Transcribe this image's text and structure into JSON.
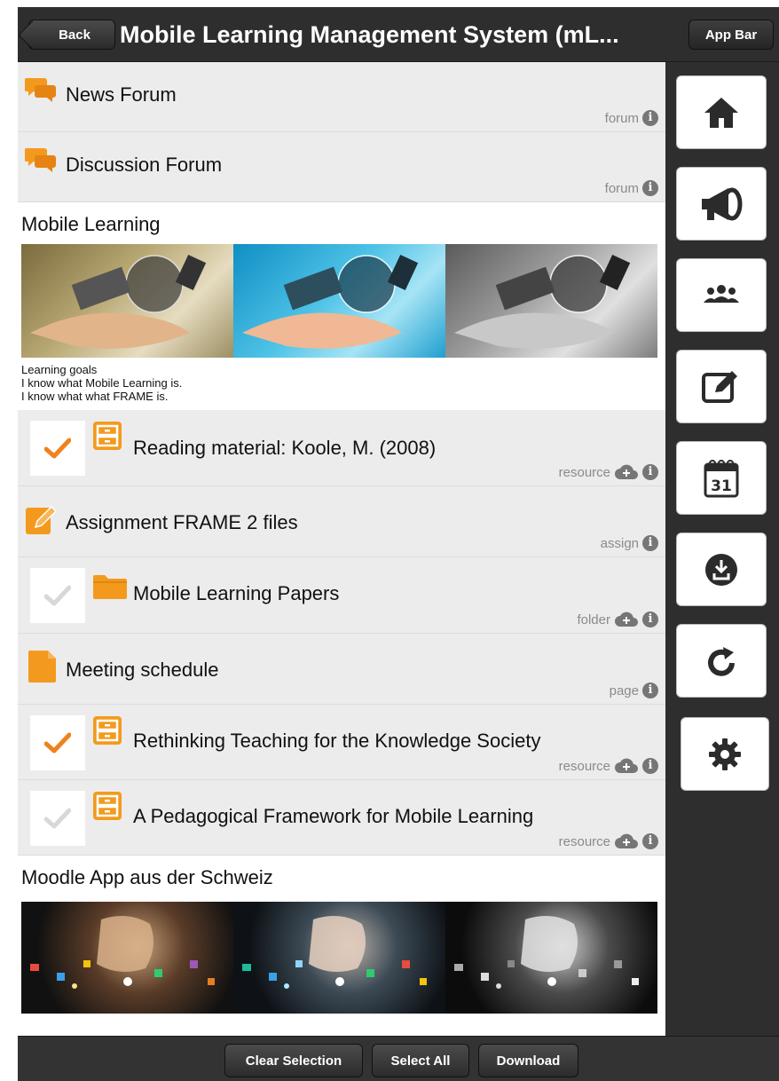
{
  "header": {
    "back_label": "Back",
    "title": "Mobile Learning Management System (mL...",
    "appbar_label": "App Bar"
  },
  "items_top": [
    {
      "title": "News Forum",
      "meta": "forum",
      "type_icon": "forum-icon"
    },
    {
      "title": "Discussion Forum",
      "meta": "forum",
      "type_icon": "forum-icon"
    }
  ],
  "section1": {
    "title": "Mobile Learning",
    "goals": [
      "Learning goals",
      "I know what Mobile Learning is.",
      "I know what what FRAME is."
    ]
  },
  "items": [
    {
      "title": "Reading material: Koole, M. (2008)",
      "meta": "resource",
      "checked": true,
      "type_icon": "resource-icon"
    },
    {
      "title": "Assignment FRAME 2 files",
      "meta": "assign",
      "type_icon": "assign-icon"
    },
    {
      "title": "Mobile Learning Papers",
      "meta": "folder",
      "checked": false,
      "type_icon": "folder-icon"
    },
    {
      "title": "Meeting schedule",
      "meta": "page",
      "type_icon": "page-icon"
    },
    {
      "title": "Rethinking Teaching for the Knowledge Society",
      "meta": "resource",
      "checked": true,
      "type_icon": "resource-icon"
    },
    {
      "title": "A Pedagogical Framework for Mobile Learning",
      "meta": "resource",
      "checked": false,
      "type_icon": "resource-icon"
    }
  ],
  "section2": {
    "title": "Moodle App aus der Schweiz"
  },
  "appbar": [
    "home-icon",
    "megaphone-icon",
    "participants-icon",
    "edit-icon",
    "calendar-icon",
    "download-icon",
    "refresh-icon",
    "settings-icon"
  ],
  "calendar_day": "31",
  "footer": {
    "clear_label": "Clear Selection",
    "select_all_label": "Select All",
    "download_label": "Download"
  },
  "colors": {
    "accent": "#f39a1e",
    "header_bg": "#2e2e2e",
    "list_bg": "#ececec",
    "checked": "#f0821e",
    "unchecked": "#d8d8d8"
  }
}
